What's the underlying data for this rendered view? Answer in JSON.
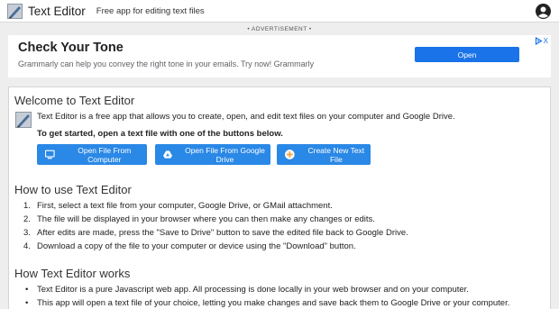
{
  "header": {
    "title": "Text Editor",
    "subtitle": "Free app for editing text files"
  },
  "ad": {
    "label": "• ADVERTISEMENT •",
    "title": "Check Your Tone",
    "text": "Grammarly can help you convey the right tone in your emails. Try now! Grammarly",
    "button_label": "Open",
    "close_label": "X"
  },
  "welcome": {
    "title": "Welcome to Text Editor",
    "intro": "Text Editor is a free app that allows you to create, open, and edit text files on your computer and Google Drive.",
    "get_started": "To get started, open a text file with one of the buttons below."
  },
  "buttons": {
    "open_computer": "Open File From Computer",
    "open_drive": "Open File From Google Drive",
    "create_new": "Create New Text File"
  },
  "how_to_use": {
    "title": "How to use Text Editor",
    "steps": [
      {
        "num": "1.",
        "text": "First, select a text file from your computer, Google Drive, or GMail attachment."
      },
      {
        "num": "2.",
        "text": "The file will be displayed in your browser where you can then make any changes or edits."
      },
      {
        "num": "3.",
        "text": "After edits are made, press the \"Save to Drive\" button to save the edited file back to Google Drive."
      },
      {
        "num": "4.",
        "text": "Download a copy of the file to your computer or device using the \"Download\" button."
      }
    ]
  },
  "how_works": {
    "title": "How Text Editor works",
    "bullet": "•",
    "points": [
      "Text Editor is a pure Javascript web app. All processing is done locally in your web browser and on your computer.",
      "This app will open a text file of your choice, letting you make changes and save back them to Google Drive or your computer."
    ]
  },
  "colors": {
    "button_blue": "#2a88e6",
    "ad_button_blue": "#1a73e8",
    "page_background": "#eeeeee"
  },
  "icons": {
    "app_logo": "pencil-paper-icon",
    "account": "account-icon",
    "computer": "computer-icon",
    "drive": "google-drive-icon",
    "add": "add-circle-icon",
    "ad_choices": "adchoices-icon"
  }
}
